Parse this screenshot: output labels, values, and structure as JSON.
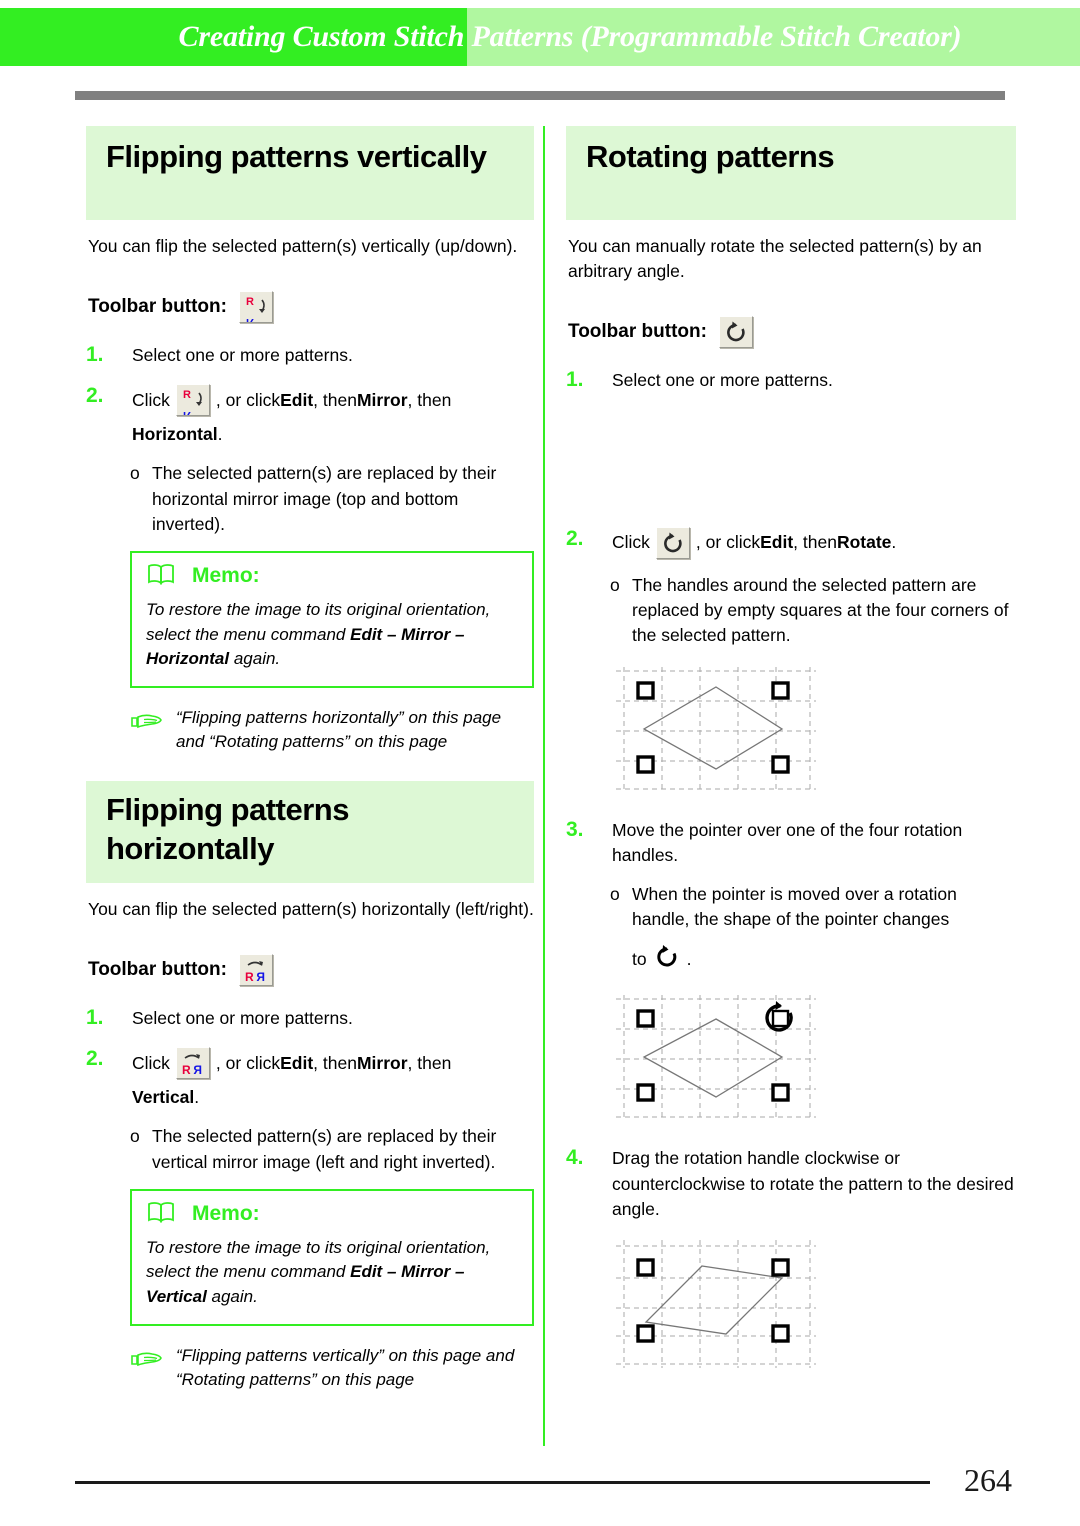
{
  "header": {
    "running_title": "Creating Custom Stitch Patterns (Programmable Stitch Creator)",
    "band_color_dark": "#33ee22",
    "band_color_light": "#b0f7a0",
    "rule_color": "#808080"
  },
  "colors": {
    "accent_green": "#33ee22",
    "heading_bg": "#ddf8d5",
    "icon_red": "#e8003c",
    "icon_blue": "#1414e6",
    "button_face": "#eceade"
  },
  "left_column": {
    "section_vertical": {
      "heading": "Flipping patterns vertically",
      "intro": "You can flip the selected pattern(s) vertically (up/down).",
      "toolbar_label": "Toolbar button:",
      "toolbar_icon": "mirror-vertical-icon",
      "steps": [
        {
          "number": "1.",
          "text": "Select one or more patterns."
        },
        {
          "number": "2.",
          "click_word": "Click",
          "icon": "mirror-vertical-icon",
          "after_icon": ", or click ",
          "menu1": "Edit",
          "sep1": ", then ",
          "menu2": "Mirror",
          "sep2": ", then",
          "menu3": "Horizontal",
          "end": ".",
          "sub_bullet": "o",
          "sub_text": "The selected pattern(s) are replaced by their horizontal mirror image (top and bottom inverted)."
        }
      ],
      "memo": {
        "icon": "book-icon",
        "title": "Memo:",
        "text_1": "To restore the image to its original orientation, select the menu command ",
        "bold_1": "Edit – Mirror – Horizontal",
        "text_2": " again."
      },
      "xref": {
        "icon": "pointing-hand-icon",
        "text": "“Flipping patterns horizontally” on this page and “Rotating patterns” on this page"
      }
    },
    "section_horizontal": {
      "heading_line1": "Flipping patterns",
      "heading_line2": "horizontally",
      "intro": "You can flip the selected pattern(s) horizontally (left/right).",
      "toolbar_label": "Toolbar button:",
      "toolbar_icon": "mirror-horizontal-icon",
      "steps": [
        {
          "number": "1.",
          "text": "Select one or more patterns."
        },
        {
          "number": "2.",
          "click_word": "Click",
          "icon": "mirror-horizontal-icon",
          "after_icon": ", or click ",
          "menu1": "Edit",
          "sep1": ", then ",
          "menu2": "Mirror",
          "sep2": ", then",
          "menu3": "Vertical",
          "end": ".",
          "sub_bullet": "o",
          "sub_text": "The selected pattern(s) are replaced by their vertical mirror image (left and right inverted)."
        }
      ],
      "memo": {
        "icon": "book-icon",
        "title": "Memo:",
        "text_1": "To restore the image to its original orientation, select the menu command ",
        "bold_1": "Edit – Mirror – Vertical",
        "text_2": " again."
      },
      "xref": {
        "icon": "pointing-hand-icon",
        "text": "“Flipping patterns vertically” on this page and “Rotating patterns” on this page"
      }
    }
  },
  "right_column": {
    "section_rotate": {
      "heading": "Rotating patterns",
      "intro": "You can manually rotate the selected pattern(s) by an arbitrary angle.",
      "toolbar_label": "Toolbar button:",
      "toolbar_icon": "rotate-icon",
      "steps": [
        {
          "number": "1.",
          "text": "Select one or more patterns."
        },
        {
          "number": "2.",
          "click_word": "Click",
          "icon": "rotate-icon",
          "after_icon": ", or click ",
          "menu1": "Edit",
          "sep1": ", then ",
          "menu2": "Rotate",
          "end": ".",
          "sub_bullet": "o",
          "sub_text": "The handles around the selected pattern are replaced by empty squares at the four corners of the selected pattern.",
          "figure": "diamond-with-four-empty-handles"
        },
        {
          "number": "3.",
          "text": "Move the pointer over one of the four rotation handles.",
          "sub_bullet": "o",
          "sub_text": "When the pointer is moved over a rotation handle, the shape of the pointer changes",
          "sub_text_tail_prefix": "to",
          "sub_text_tail_icon": "rotate-cursor-icon",
          "sub_text_tail_suffix": ".",
          "figure": "diamond-with-rotate-cursor"
        },
        {
          "number": "4.",
          "text": "Drag the rotation handle clockwise or counterclockwise to rotate the pattern to the desired angle.",
          "figure": "rotated-parallelogram"
        }
      ]
    }
  },
  "footer": {
    "page_number": "264"
  }
}
